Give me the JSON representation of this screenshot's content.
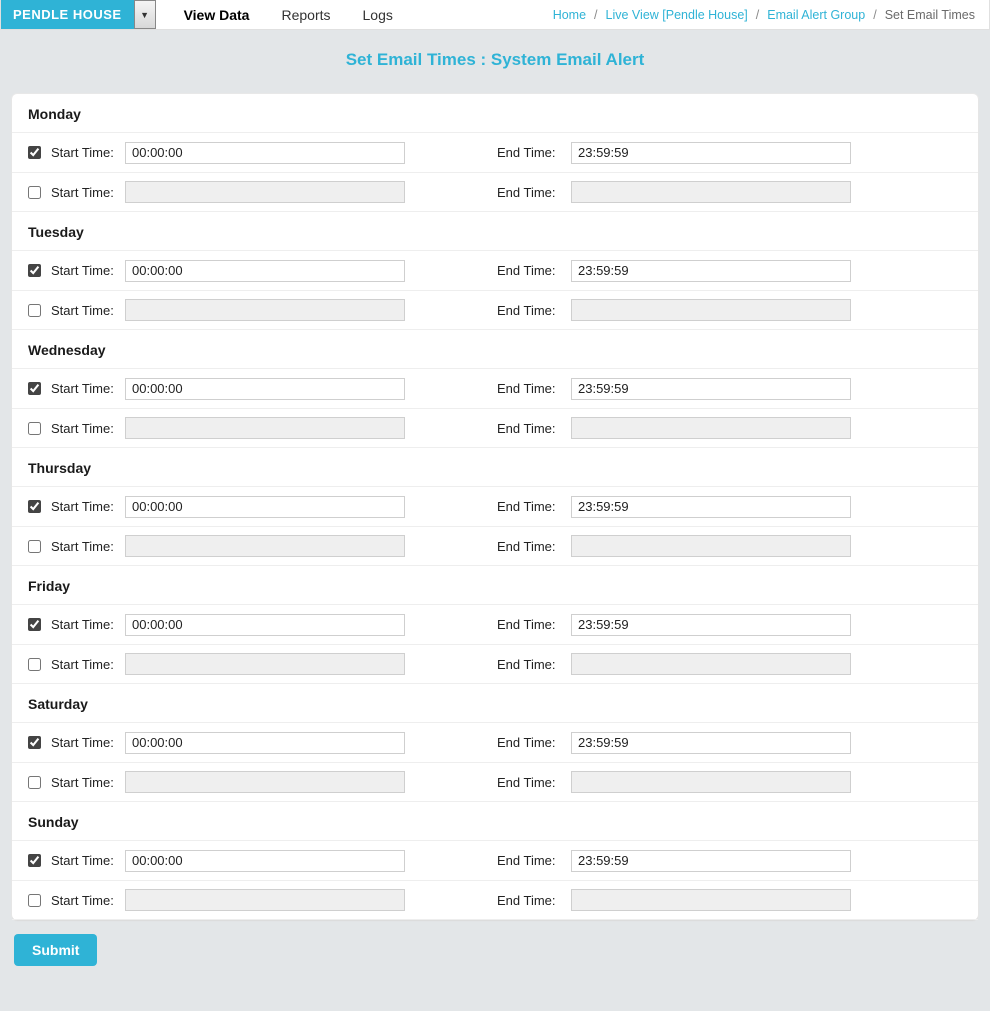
{
  "site_name": "PENDLE HOUSE",
  "nav": {
    "view_data": "View Data",
    "reports": "Reports",
    "logs": "Logs"
  },
  "breadcrumbs": {
    "home": "Home",
    "live_view": "Live View [Pendle House]",
    "email_group": "Email Alert Group",
    "current": "Set Email Times"
  },
  "page_title": "Set Email Times : System Email Alert",
  "labels": {
    "start_time": "Start Time:",
    "end_time": "End Time:",
    "submit": "Submit"
  },
  "days": [
    {
      "name": "Monday",
      "slots": [
        {
          "enabled": true,
          "start": "00:00:00",
          "end": "23:59:59"
        },
        {
          "enabled": false,
          "start": "",
          "end": ""
        }
      ]
    },
    {
      "name": "Tuesday",
      "slots": [
        {
          "enabled": true,
          "start": "00:00:00",
          "end": "23:59:59"
        },
        {
          "enabled": false,
          "start": "",
          "end": ""
        }
      ]
    },
    {
      "name": "Wednesday",
      "slots": [
        {
          "enabled": true,
          "start": "00:00:00",
          "end": "23:59:59"
        },
        {
          "enabled": false,
          "start": "",
          "end": ""
        }
      ]
    },
    {
      "name": "Thursday",
      "slots": [
        {
          "enabled": true,
          "start": "00:00:00",
          "end": "23:59:59"
        },
        {
          "enabled": false,
          "start": "",
          "end": ""
        }
      ]
    },
    {
      "name": "Friday",
      "slots": [
        {
          "enabled": true,
          "start": "00:00:00",
          "end": "23:59:59"
        },
        {
          "enabled": false,
          "start": "",
          "end": ""
        }
      ]
    },
    {
      "name": "Saturday",
      "slots": [
        {
          "enabled": true,
          "start": "00:00:00",
          "end": "23:59:59"
        },
        {
          "enabled": false,
          "start": "",
          "end": ""
        }
      ]
    },
    {
      "name": "Sunday",
      "slots": [
        {
          "enabled": true,
          "start": "00:00:00",
          "end": "23:59:59"
        },
        {
          "enabled": false,
          "start": "",
          "end": ""
        }
      ]
    }
  ]
}
